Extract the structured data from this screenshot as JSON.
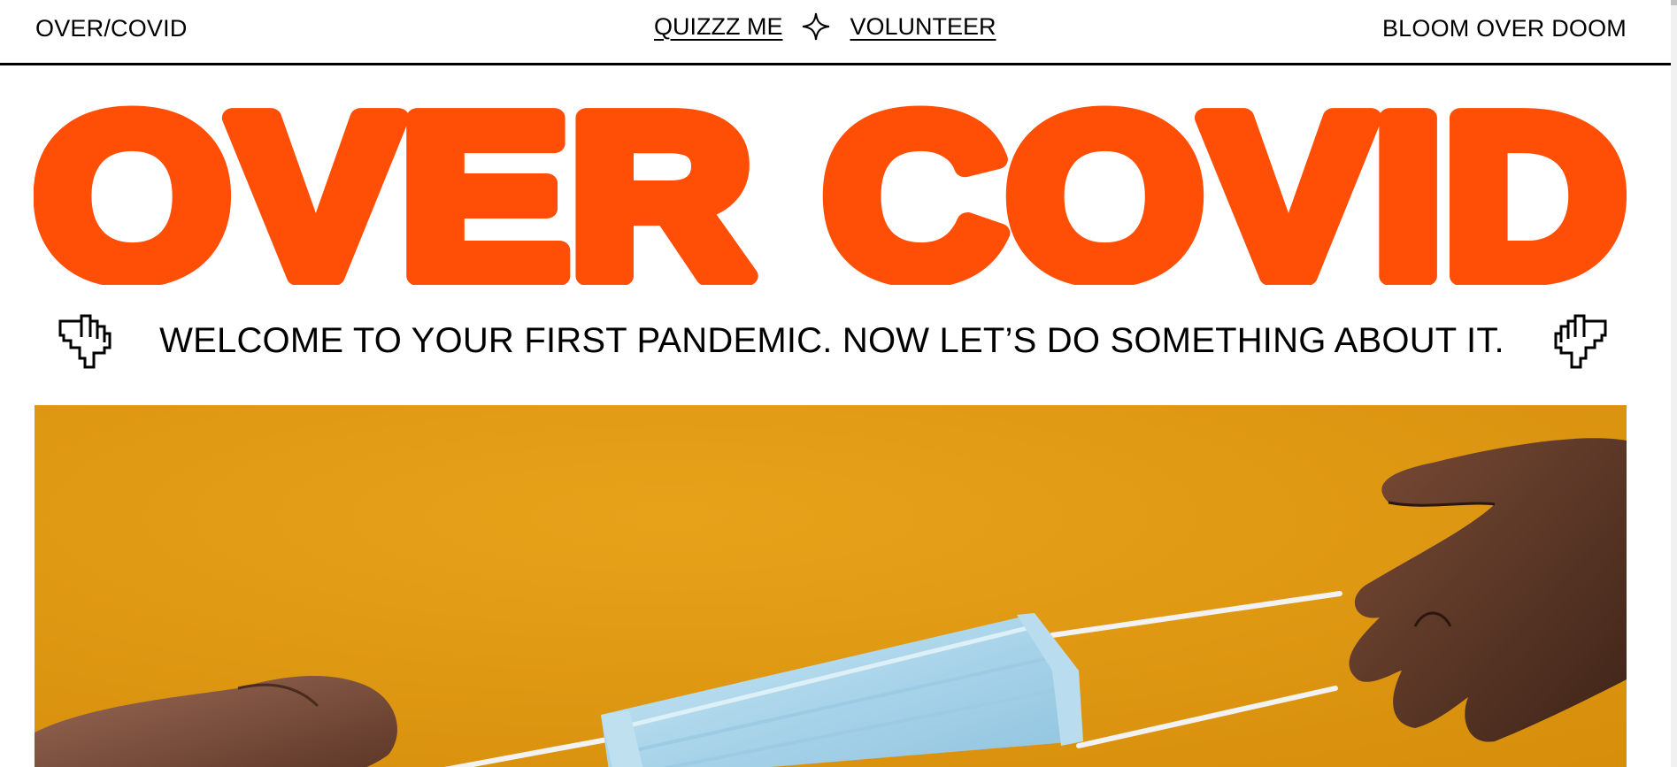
{
  "nav": {
    "brand": "OVER/COVID",
    "links": [
      {
        "label": "QUIZZZ ME"
      },
      {
        "label": "VOLUNTEER"
      }
    ],
    "tagline": "BLOOM OVER DOOM"
  },
  "hero": {
    "title": "OVER COVID"
  },
  "welcome": {
    "text": "WELCOME TO YOUR FIRST PANDEMIC. NOW LET’S DO SOMETHING ABOUT IT."
  },
  "colors": {
    "accent": "#FF4F06",
    "photo_background": "#E09B12",
    "text": "#000000"
  },
  "icons": [
    "sparkle-icon",
    "pointing-hand-icon"
  ]
}
